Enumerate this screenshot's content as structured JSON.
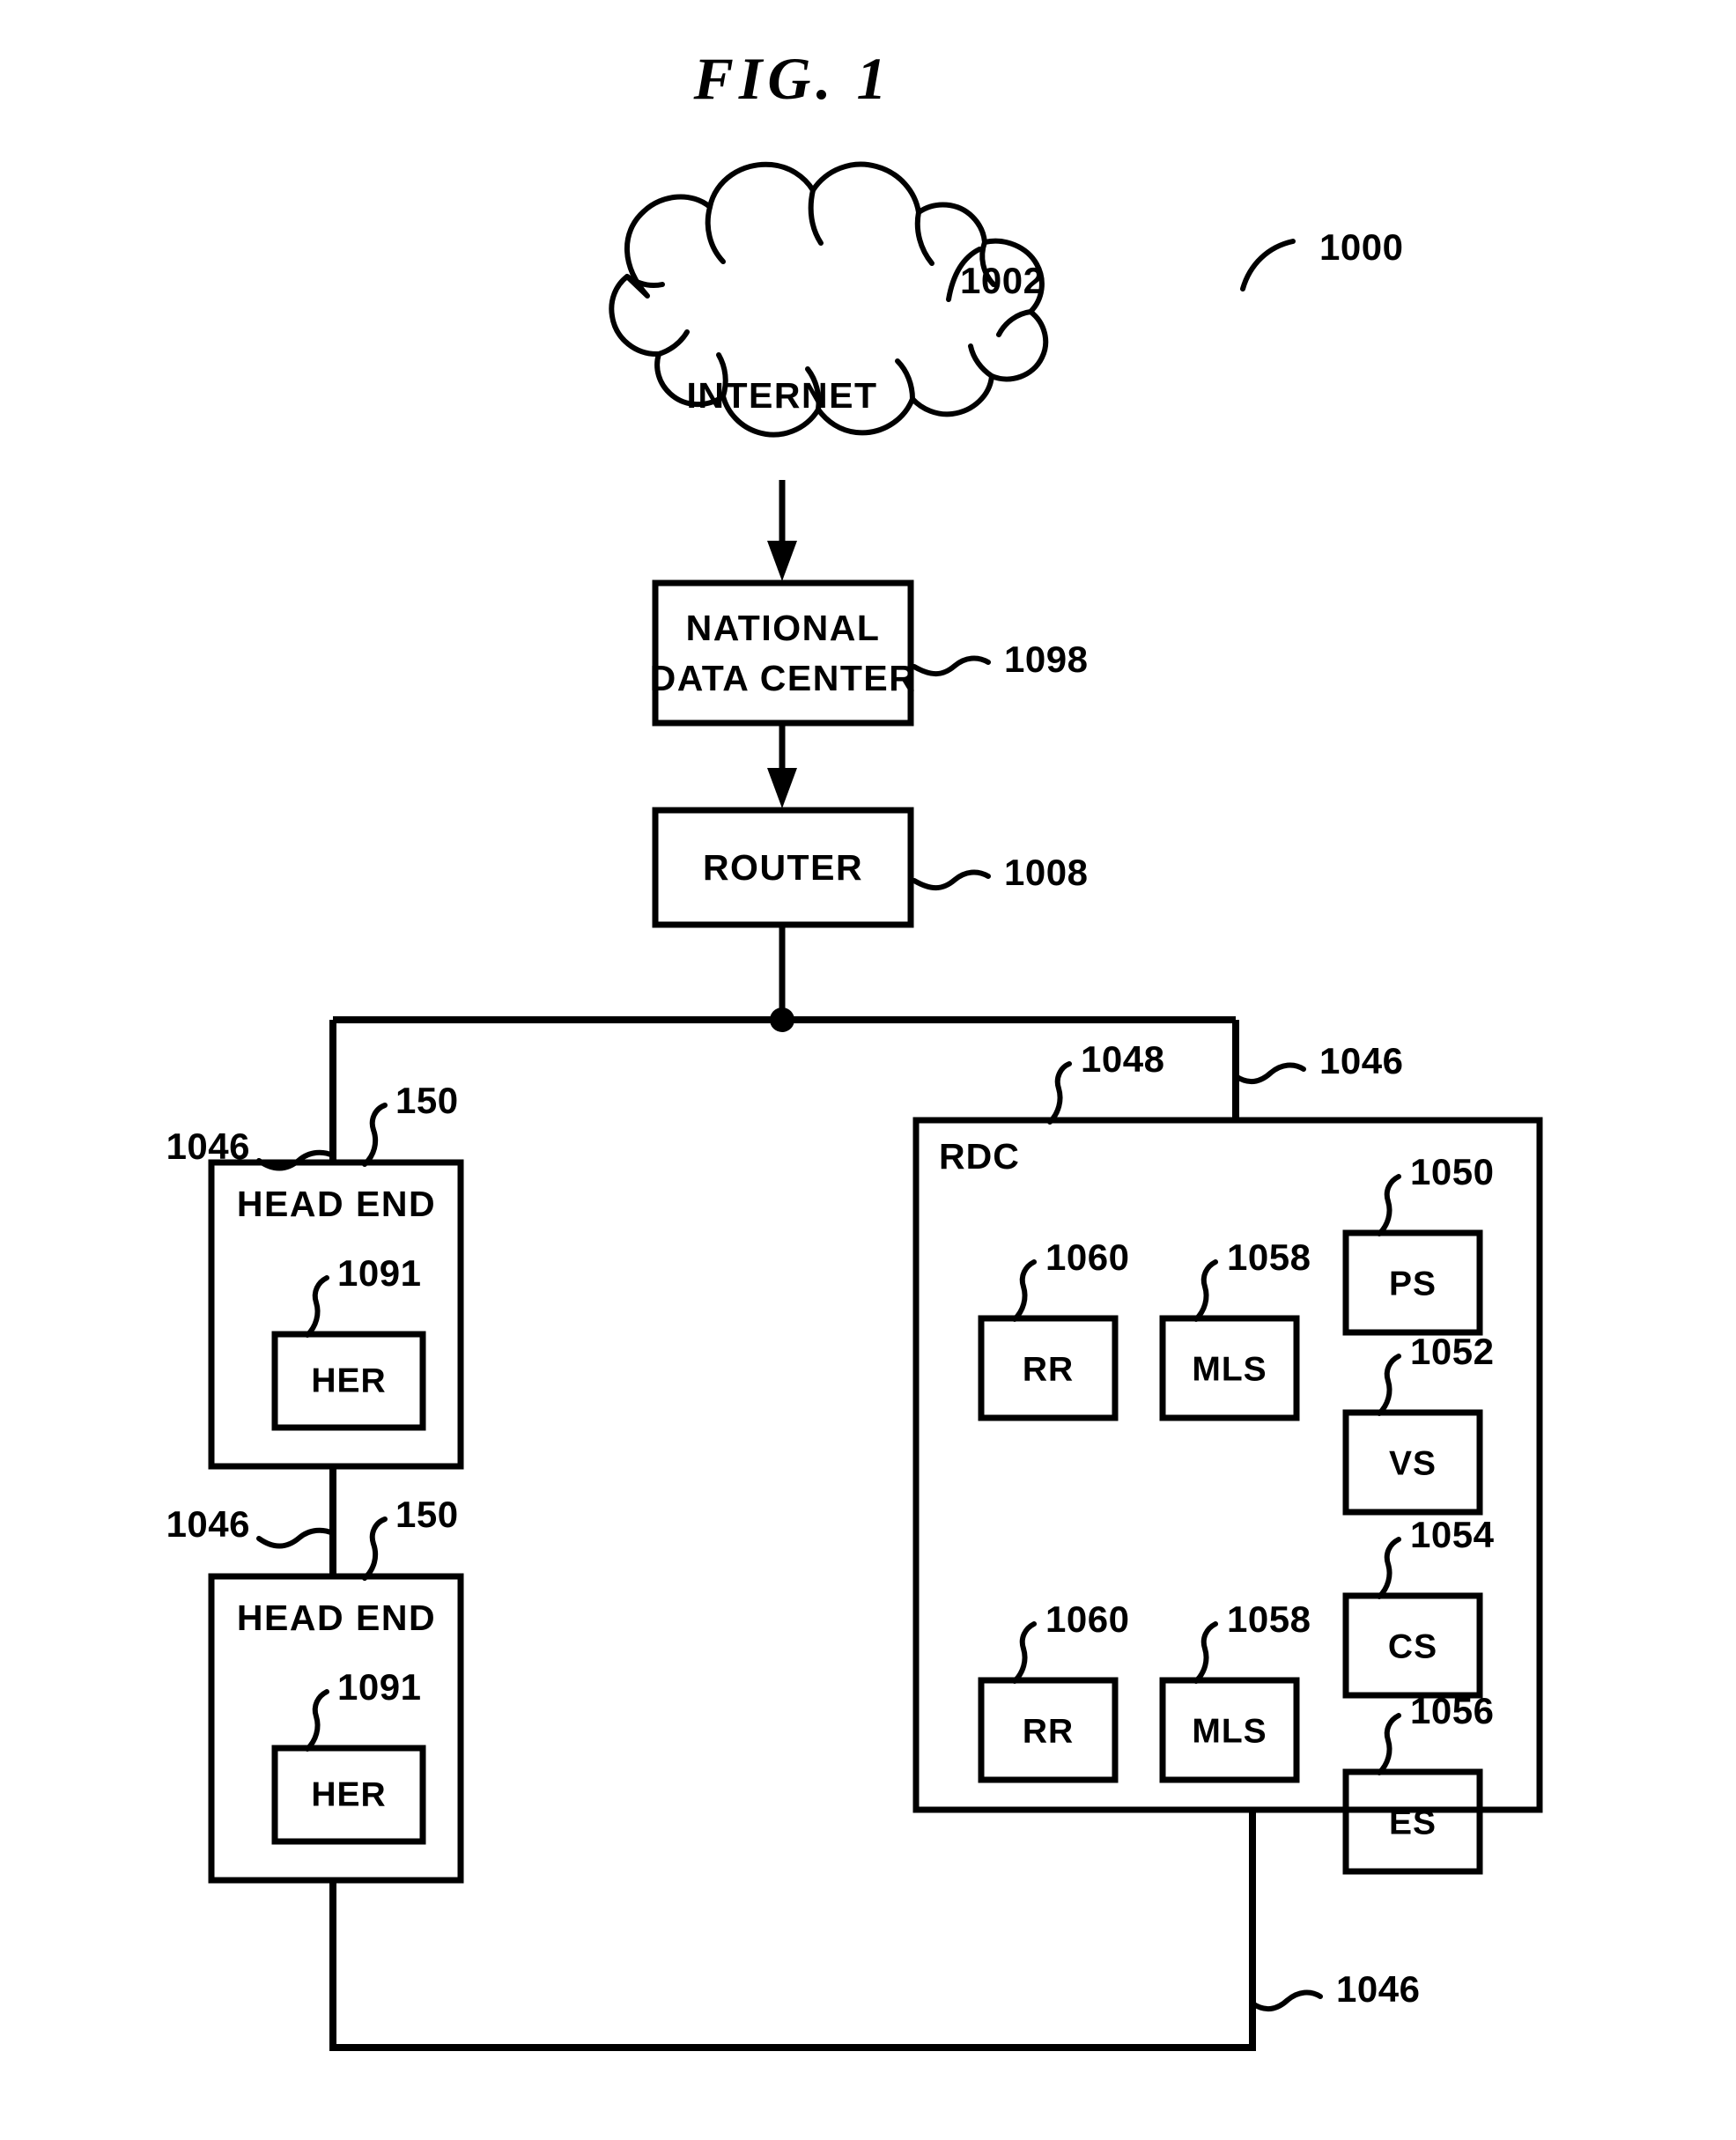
{
  "figure": {
    "title": "FIG.  1",
    "system_ref": "1000"
  },
  "nodes": {
    "internet": {
      "label": "INTERNET",
      "ref": "1002"
    },
    "national_data_center": {
      "label_line1": "NATIONAL",
      "label_line2": "DATA  CENTER",
      "ref": "1098"
    },
    "router": {
      "label": "ROUTER",
      "ref": "1008"
    },
    "head_end_1": {
      "label": "HEAD END",
      "ref": "150",
      "child": {
        "label": "HER",
        "ref": "1091"
      }
    },
    "head_end_2": {
      "label": "HEAD END",
      "ref": "150",
      "child": {
        "label": "HER",
        "ref": "1091"
      }
    },
    "rdc": {
      "label": "RDC",
      "ref": "1048",
      "components": [
        {
          "label": "RR",
          "ref": "1060"
        },
        {
          "label": "MLS",
          "ref": "1058"
        },
        {
          "label": "PS",
          "ref": "1050"
        },
        {
          "label": "VS",
          "ref": "1052"
        },
        {
          "label": "CS",
          "ref": "1054"
        },
        {
          "label": "ES",
          "ref": "1056"
        },
        {
          "label": "RR",
          "ref": "1060"
        },
        {
          "label": "MLS",
          "ref": "1058"
        }
      ]
    }
  },
  "network_refs": {
    "bus_left_upper": "1046",
    "bus_left_middle": "1046",
    "bus_right_top": "1046",
    "bus_bottom": "1046"
  },
  "colors": {
    "ink": "#000000",
    "paper": "#ffffff"
  }
}
